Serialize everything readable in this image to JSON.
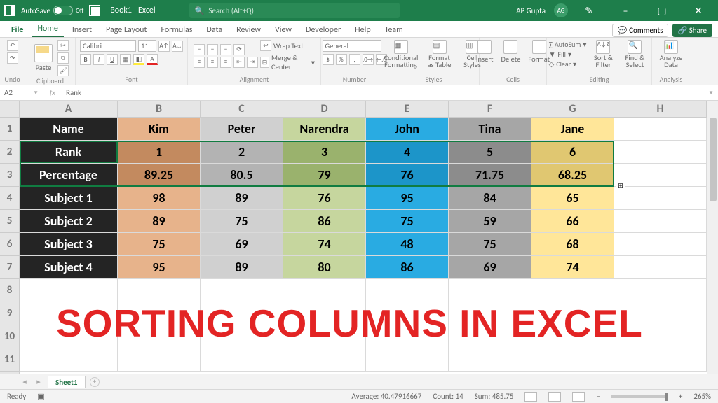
{
  "titlebar": {
    "autosave_label": "AutoSave",
    "autosave_state": "Off",
    "doc_title": "Book1 - Excel",
    "search_placeholder": "Search (Alt+Q)",
    "user_name": "AP Gupta",
    "user_initials": "AG"
  },
  "tabs": {
    "file": "File",
    "list": [
      "Home",
      "Insert",
      "Page Layout",
      "Formulas",
      "Data",
      "Review",
      "View",
      "Developer",
      "Help",
      "Team"
    ],
    "active": "Home",
    "comments": "Comments",
    "share": "Share"
  },
  "ribbon": {
    "undo": "Undo",
    "clipboard": "Clipboard",
    "paste": "Paste",
    "font_group": "Font",
    "font_name": "Calibri",
    "font_size": "11",
    "alignment": "Alignment",
    "wrap": "Wrap Text",
    "merge": "Merge & Center",
    "number": "Number",
    "numfmt": "General",
    "styles": "Styles",
    "cond": "Conditional Formatting",
    "fmttbl": "Format as Table",
    "cellsty": "Cell Styles",
    "cells": "Cells",
    "insert": "Insert",
    "delete": "Delete",
    "format": "Format",
    "editing": "Editing",
    "autosum": "AutoSum",
    "fill": "Fill",
    "clear": "Clear",
    "sort": "Sort & Filter",
    "find": "Find & Select",
    "analysis": "Analysis",
    "analyze": "Analyze Data"
  },
  "formula_bar": {
    "name_box": "A2",
    "fx": "fx",
    "value": "Rank"
  },
  "columns": [
    "A",
    "B",
    "C",
    "D",
    "E",
    "F",
    "G",
    "H"
  ],
  "rows": [
    "1",
    "2",
    "3",
    "4",
    "5",
    "6",
    "7",
    "8",
    "9",
    "10",
    "11"
  ],
  "data": {
    "A": [
      "Name",
      "Rank",
      "Percentage",
      "Subject 1",
      "Subject 2",
      "Subject 3",
      "Subject 4"
    ],
    "B": [
      "Kim",
      "1",
      "89.25",
      "98",
      "89",
      "75",
      "95"
    ],
    "C": [
      "Peter",
      "2",
      "80.5",
      "89",
      "75",
      "69",
      "89"
    ],
    "D": [
      "Narendra",
      "3",
      "79",
      "76",
      "86",
      "74",
      "80"
    ],
    "E": [
      "John",
      "4",
      "76",
      "95",
      "75",
      "48",
      "86"
    ],
    "F": [
      "Tina",
      "5",
      "71.75",
      "84",
      "59",
      "75",
      "69"
    ],
    "G": [
      "Jane",
      "6",
      "68.25",
      "65",
      "66",
      "68",
      "74"
    ]
  },
  "overlay": "SORTING COLUMNS IN EXCEL",
  "sheet_tabs": {
    "sheet": "Sheet1"
  },
  "status": {
    "ready": "Ready",
    "avg": "Average: 40.47916667",
    "count": "Count: 14",
    "sum": "Sum: 485.75",
    "zoom": "265%"
  },
  "chart_data": {
    "type": "table",
    "title": "Sorting Columns in Excel",
    "columns": [
      "Name",
      "Kim",
      "Peter",
      "Narendra",
      "John",
      "Tina",
      "Jane"
    ],
    "rows": [
      {
        "label": "Rank",
        "values": [
          1,
          2,
          3,
          4,
          5,
          6
        ]
      },
      {
        "label": "Percentage",
        "values": [
          89.25,
          80.5,
          79,
          76,
          71.75,
          68.25
        ]
      },
      {
        "label": "Subject 1",
        "values": [
          98,
          89,
          76,
          95,
          84,
          65
        ]
      },
      {
        "label": "Subject 2",
        "values": [
          89,
          75,
          86,
          75,
          59,
          66
        ]
      },
      {
        "label": "Subject 3",
        "values": [
          75,
          69,
          74,
          48,
          75,
          68
        ]
      },
      {
        "label": "Subject 4",
        "values": [
          95,
          89,
          80,
          86,
          69,
          74
        ]
      }
    ]
  }
}
